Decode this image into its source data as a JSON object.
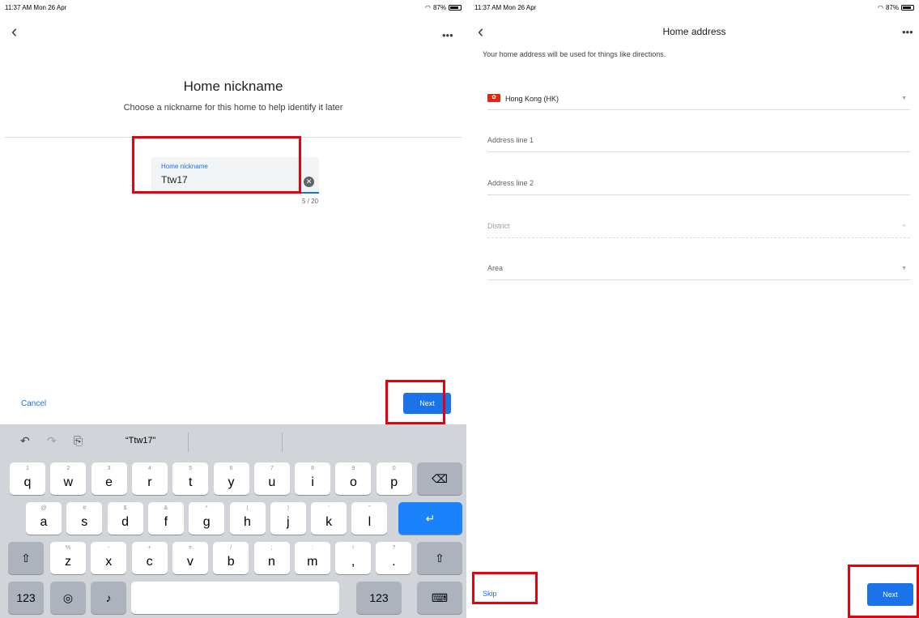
{
  "left": {
    "status": {
      "time": "11:37 AM  Mon 26 Apr",
      "battery": "87%",
      "battery_level": 0.87
    },
    "more": "•••",
    "title": "Home nickname",
    "subtitle": "Choose a nickname for this home to help identify it later",
    "field": {
      "label": "Home nickname",
      "value": "Ttw17"
    },
    "counter": "5 / 20",
    "cancel": "Cancel",
    "next": "Next",
    "keyboard": {
      "suggestion": "“Ttw17”",
      "row1": [
        {
          "hint": "1",
          "ch": "q"
        },
        {
          "hint": "2",
          "ch": "w"
        },
        {
          "hint": "3",
          "ch": "e"
        },
        {
          "hint": "4",
          "ch": "r"
        },
        {
          "hint": "5",
          "ch": "t"
        },
        {
          "hint": "6",
          "ch": "y"
        },
        {
          "hint": "7",
          "ch": "u"
        },
        {
          "hint": "8",
          "ch": "i"
        },
        {
          "hint": "9",
          "ch": "o"
        },
        {
          "hint": "0",
          "ch": "p"
        }
      ],
      "row2": [
        {
          "hint": "@",
          "ch": "a"
        },
        {
          "hint": "#",
          "ch": "s"
        },
        {
          "hint": "$",
          "ch": "d"
        },
        {
          "hint": "&",
          "ch": "f"
        },
        {
          "hint": "*",
          "ch": "g"
        },
        {
          "hint": "(",
          "ch": "h"
        },
        {
          "hint": ")",
          "ch": "j"
        },
        {
          "hint": "’",
          "ch": "k"
        },
        {
          "hint": "”",
          "ch": "l"
        }
      ],
      "row3": [
        {
          "hint": "%",
          "ch": "z"
        },
        {
          "hint": "-",
          "ch": "x"
        },
        {
          "hint": "+",
          "ch": "c"
        },
        {
          "hint": "=",
          "ch": "v"
        },
        {
          "hint": "/",
          "ch": "b"
        },
        {
          "hint": ";",
          "ch": "n"
        },
        {
          "hint": ":",
          "ch": "m"
        },
        {
          "hint": "!",
          "ch": ","
        },
        {
          "hint": "?",
          "ch": "."
        }
      ],
      "num_label": "123"
    }
  },
  "right": {
    "status": {
      "time": "11:37 AM  Mon 26 Apr",
      "battery": "87%",
      "battery_level": 0.87
    },
    "more": "•••",
    "title": "Home address",
    "description": "Your home address will be used for things like directions.",
    "country": "Hong Kong (HK)",
    "address1": "Address line 1",
    "address2": "Address line 2",
    "district": "District",
    "area": "Area",
    "skip": "Skip",
    "next": "Next"
  }
}
